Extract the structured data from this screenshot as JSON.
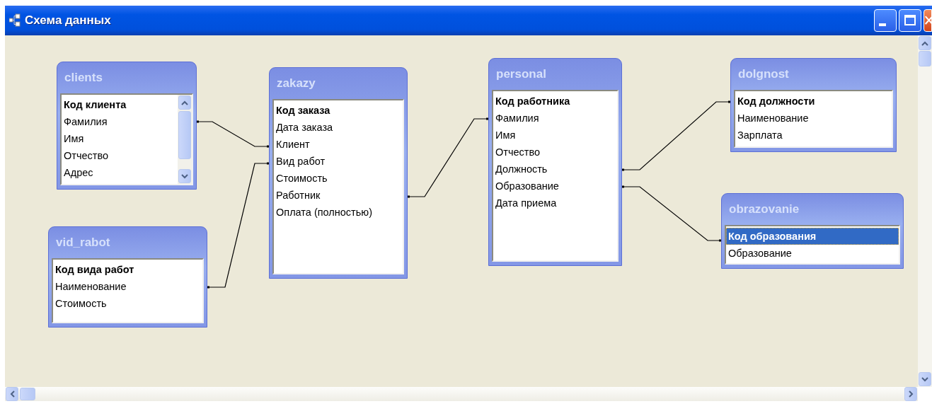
{
  "window": {
    "title": "Схема данных",
    "controls": [
      {
        "kind": "minimize"
      },
      {
        "kind": "maximize"
      },
      {
        "kind": "close"
      }
    ]
  },
  "tables": [
    {
      "name": "clients",
      "scrollbar": true,
      "fields": [
        {
          "name": "Код клиента",
          "primary_key": true,
          "selected": false
        },
        {
          "name": "Фамилия",
          "primary_key": false,
          "selected": false
        },
        {
          "name": "Имя",
          "primary_key": false,
          "selected": false
        },
        {
          "name": "Отчество",
          "primary_key": false,
          "selected": false
        },
        {
          "name": "Адрес",
          "primary_key": false,
          "selected": false
        }
      ]
    },
    {
      "name": "zakazy",
      "scrollbar": false,
      "fields": [
        {
          "name": "Код заказа",
          "primary_key": true,
          "selected": false
        },
        {
          "name": "Дата заказа",
          "primary_key": false,
          "selected": false
        },
        {
          "name": "Клиент",
          "primary_key": false,
          "selected": false
        },
        {
          "name": "Вид работ",
          "primary_key": false,
          "selected": false
        },
        {
          "name": "Стоимость",
          "primary_key": false,
          "selected": false
        },
        {
          "name": "Работник",
          "primary_key": false,
          "selected": false
        },
        {
          "name": "Оплата (полностью)",
          "primary_key": false,
          "selected": false
        }
      ]
    },
    {
      "name": "vid_rabot",
      "scrollbar": false,
      "fields": [
        {
          "name": "Код вида работ",
          "primary_key": true,
          "selected": false
        },
        {
          "name": "Наименование",
          "primary_key": false,
          "selected": false
        },
        {
          "name": "Стоимость",
          "primary_key": false,
          "selected": false
        }
      ]
    },
    {
      "name": "personal",
      "scrollbar": false,
      "fields": [
        {
          "name": "Код работника",
          "primary_key": true,
          "selected": false
        },
        {
          "name": "Фамилия",
          "primary_key": false,
          "selected": false
        },
        {
          "name": "Имя",
          "primary_key": false,
          "selected": false
        },
        {
          "name": "Отчество",
          "primary_key": false,
          "selected": false
        },
        {
          "name": "Должность",
          "primary_key": false,
          "selected": false
        },
        {
          "name": "Образование",
          "primary_key": false,
          "selected": false
        },
        {
          "name": "Дата приема",
          "primary_key": false,
          "selected": false
        }
      ]
    },
    {
      "name": "dolgnost",
      "scrollbar": false,
      "fields": [
        {
          "name": "Код должности",
          "primary_key": true,
          "selected": false
        },
        {
          "name": "Наименование",
          "primary_key": false,
          "selected": false
        },
        {
          "name": "Зарплата",
          "primary_key": false,
          "selected": false
        }
      ]
    },
    {
      "name": "obrazovanie",
      "scrollbar": false,
      "fields": [
        {
          "name": "Код образования",
          "primary_key": true,
          "selected": true
        },
        {
          "name": "Образование",
          "primary_key": false,
          "selected": false
        }
      ]
    }
  ]
}
